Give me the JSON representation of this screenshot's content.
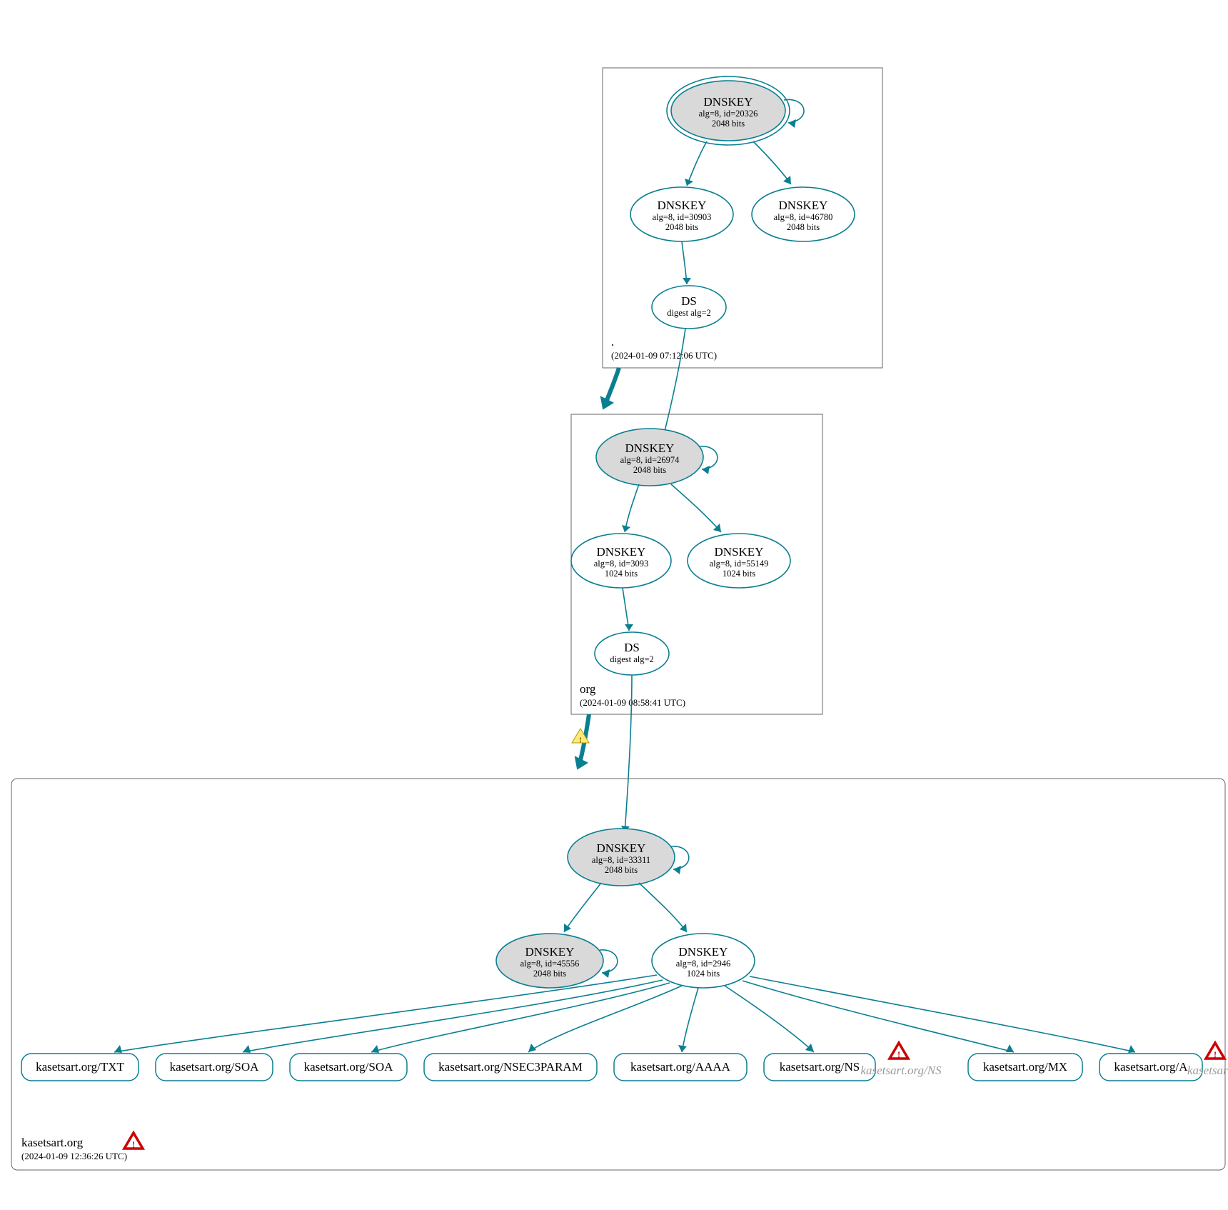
{
  "colors": {
    "teal": "#0a7f91",
    "greyFill": "#d9d9d9",
    "boxStroke": "#666666"
  },
  "zones": {
    "root": {
      "label": ".",
      "timestamp": "(2024-01-09 07:12:06 UTC)",
      "nodes": {
        "ksk": {
          "title": "DNSKEY",
          "sub1": "alg=8, id=20326",
          "sub2": "2048 bits"
        },
        "zskL": {
          "title": "DNSKEY",
          "sub1": "alg=8, id=30903",
          "sub2": "2048 bits"
        },
        "zskR": {
          "title": "DNSKEY",
          "sub1": "alg=8, id=46780",
          "sub2": "2048 bits"
        },
        "ds": {
          "title": "DS",
          "sub1": "digest alg=2"
        }
      }
    },
    "org": {
      "label": "org",
      "timestamp": "(2024-01-09 08:58:41 UTC)",
      "nodes": {
        "ksk": {
          "title": "DNSKEY",
          "sub1": "alg=8, id=26974",
          "sub2": "2048 bits"
        },
        "zskL": {
          "title": "DNSKEY",
          "sub1": "alg=8, id=3093",
          "sub2": "1024 bits"
        },
        "zskR": {
          "title": "DNSKEY",
          "sub1": "alg=8, id=55149",
          "sub2": "1024 bits"
        },
        "ds": {
          "title": "DS",
          "sub1": "digest alg=2"
        }
      }
    },
    "kasetsart": {
      "label": "kasetsart.org",
      "timestamp": "(2024-01-09 12:36:26 UTC)",
      "nodes": {
        "ksk": {
          "title": "DNSKEY",
          "sub1": "alg=8, id=33311",
          "sub2": "2048 bits"
        },
        "zskL": {
          "title": "DNSKEY",
          "sub1": "alg=8, id=45556",
          "sub2": "2048 bits"
        },
        "zskR": {
          "title": "DNSKEY",
          "sub1": "alg=8, id=2946",
          "sub2": "1024 bits"
        }
      },
      "rrsets": {
        "txt": "kasetsart.org/TXT",
        "soa1": "kasetsart.org/SOA",
        "soa2": "kasetsart.org/SOA",
        "nsec": "kasetsart.org/NSEC3PARAM",
        "aaaa": "kasetsart.org/AAAA",
        "ns": "kasetsart.org/NS",
        "ns_err": "kasetsart.org/NS",
        "mx": "kasetsart.org/MX",
        "a": "kasetsart.org/A",
        "a_err": "kasetsart.org/A"
      }
    }
  }
}
